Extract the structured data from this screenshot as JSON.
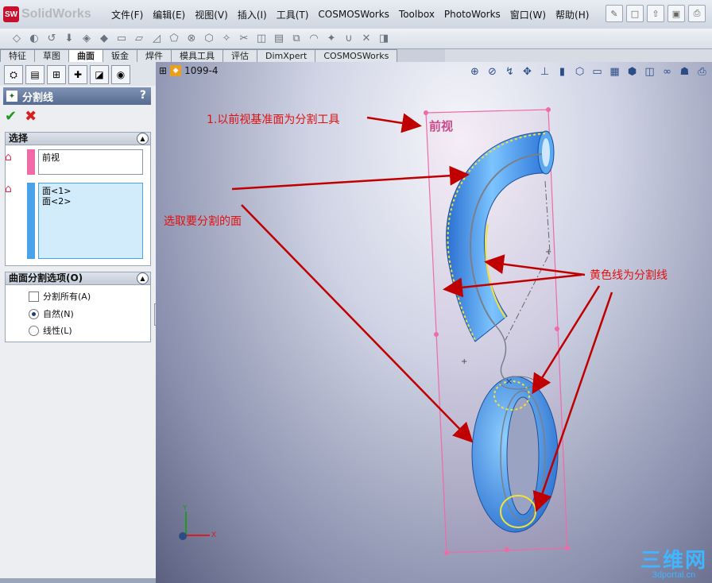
{
  "app": {
    "logo_text": "SolidWorks",
    "logo_badge": "SW"
  },
  "menu": [
    "文件(F)",
    "编辑(E)",
    "视图(V)",
    "插入(I)",
    "工具(T)",
    "COSMOSWorks",
    "Toolbox",
    "PhotoWorks",
    "窗口(W)",
    "帮助(H)"
  ],
  "tabs": [
    "特征",
    "草图",
    "曲面",
    "钣金",
    "焊件",
    "模具工具",
    "评估",
    "DimXpert",
    "COSMOSWorks"
  ],
  "active_tab": "曲面",
  "panel": {
    "title": "分割线",
    "help": "?",
    "selection": {
      "heading": "选择",
      "plane_value": "前视",
      "faces": [
        "面<1>",
        "面<2>"
      ]
    },
    "options": {
      "heading": "曲面分割选项(O)",
      "split_all": "分割所有(A)",
      "natural": "自然(N)",
      "linear": "线性(L)"
    }
  },
  "viewport": {
    "part_name": "1099-4",
    "plane_label": "前视",
    "annotations": {
      "tool": "1.以前视基准面为分割工具",
      "pick_faces": "选取要分割的面",
      "yellow_lines": "黄色线为分割线"
    },
    "axes": {
      "x": "X",
      "y": "Y"
    }
  },
  "watermark": {
    "line1": "三维网",
    "line2": "3dportal.cn"
  },
  "colors": {
    "accent_red": "#e01010",
    "part_blue": "#3a8ee8",
    "plane_pink": "#f06aa8",
    "split_yellow": "#f2e13a"
  }
}
